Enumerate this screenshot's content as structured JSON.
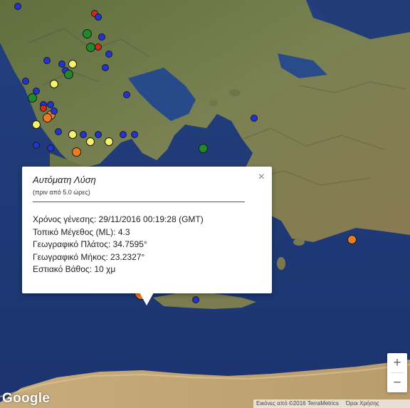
{
  "popup": {
    "title": "Αυτόματη Λύση",
    "subtitle": "(πριν από 5.0 ώρες)",
    "lines": [
      "Χρόνος γένεσης: 29/11/2016  00:19:28 (GMT)",
      "Τοπικό Μέγεθος (ML): 4.3",
      "Γεωγραφικό Πλάτος: 34.7595°",
      "Γεωγραφικό Μήκος: 23.2327°",
      "Εστιακό Βάθος: 10 χμ"
    ],
    "close_label": "×"
  },
  "zoom": {
    "in_label": "+",
    "out_label": "−"
  },
  "google_logo": "Google",
  "attribution": {
    "imagery": "Εικόνες από ©2016 TerraMetrics",
    "terms": "Όροι Χρήσης"
  },
  "colors": {
    "sea": "#1f3f7c",
    "land": "#6b7a4a",
    "marker_blue": "#1f33d6",
    "marker_green": "#1e8a2a",
    "marker_yellow": "#f6f36a",
    "marker_orange": "#ee7a22",
    "marker_red": "#d8281b"
  },
  "markers": [
    {
      "color": "marker_blue",
      "lat": 45.1,
      "lon": 19.4
    },
    {
      "color": "marker_red",
      "lat": 44.9,
      "lon": 21.5
    },
    {
      "color": "marker_blue",
      "lat": 44.8,
      "lon": 21.6
    },
    {
      "color": "marker_green",
      "lat": 44.3,
      "lon": 21.3
    },
    {
      "color": "marker_blue",
      "lat": 44.2,
      "lon": 21.7
    },
    {
      "color": "marker_green",
      "lat": 43.9,
      "lon": 21.4
    },
    {
      "color": "marker_red",
      "lat": 43.9,
      "lon": 21.6
    },
    {
      "color": "marker_blue",
      "lat": 43.7,
      "lon": 21.9
    },
    {
      "color": "marker_blue",
      "lat": 43.5,
      "lon": 20.2
    },
    {
      "color": "marker_yellow",
      "lat": 43.4,
      "lon": 20.9
    },
    {
      "color": "marker_blue",
      "lat": 43.4,
      "lon": 20.6
    },
    {
      "color": "marker_blue",
      "lat": 43.2,
      "lon": 20.7
    },
    {
      "color": "marker_green",
      "lat": 43.1,
      "lon": 20.8
    },
    {
      "color": "marker_blue",
      "lat": 42.9,
      "lon": 19.6
    },
    {
      "color": "marker_yellow",
      "lat": 42.8,
      "lon": 20.4
    },
    {
      "color": "marker_blue",
      "lat": 42.6,
      "lon": 19.9
    },
    {
      "color": "marker_green",
      "lat": 42.4,
      "lon": 19.8
    },
    {
      "color": "marker_blue",
      "lat": 42.2,
      "lon": 20.3
    },
    {
      "color": "marker_blue",
      "lat": 42.2,
      "lon": 20.1
    },
    {
      "color": "marker_red",
      "lat": 42.1,
      "lon": 20.1
    },
    {
      "color": "marker_orange",
      "lat": 41.9,
      "lon": 20.3
    },
    {
      "color": "marker_orange",
      "lat": 41.8,
      "lon": 20.2
    },
    {
      "color": "marker_blue",
      "lat": 42.0,
      "lon": 20.4
    },
    {
      "color": "marker_yellow",
      "lat": 41.6,
      "lon": 19.9
    },
    {
      "color": "marker_blue",
      "lat": 41.4,
      "lon": 20.5
    },
    {
      "color": "marker_yellow",
      "lat": 41.3,
      "lon": 20.9
    },
    {
      "color": "marker_blue",
      "lat": 41.3,
      "lon": 21.2
    },
    {
      "color": "marker_yellow",
      "lat": 41.1,
      "lon": 21.4
    },
    {
      "color": "marker_blue",
      "lat": 41.3,
      "lon": 21.6
    },
    {
      "color": "marker_yellow",
      "lat": 41.1,
      "lon": 21.9
    },
    {
      "color": "marker_blue",
      "lat": 41.0,
      "lon": 19.9
    },
    {
      "color": "marker_blue",
      "lat": 40.9,
      "lon": 20.3
    },
    {
      "color": "marker_orange",
      "lat": 40.8,
      "lon": 21.0
    },
    {
      "color": "marker_blue",
      "lat": 41.3,
      "lon": 22.3
    },
    {
      "color": "marker_blue",
      "lat": 41.3,
      "lon": 22.6
    },
    {
      "color": "marker_blue",
      "lat": 42.5,
      "lon": 22.4
    },
    {
      "color": "marker_blue",
      "lat": 43.3,
      "lon": 21.8
    },
    {
      "color": "marker_blue",
      "lat": 41.8,
      "lon": 25.9
    },
    {
      "color": "marker_green",
      "lat": 40.9,
      "lon": 24.5
    },
    {
      "color": "marker_orange",
      "lat": 38.2,
      "lon": 28.6
    },
    {
      "color": "marker_orange",
      "lat": 36.6,
      "lon": 22.8
    },
    {
      "color": "marker_blue",
      "lat": 36.7,
      "lon": 23.3
    },
    {
      "color": "marker_blue",
      "lat": 36.4,
      "lon": 24.3
    }
  ]
}
